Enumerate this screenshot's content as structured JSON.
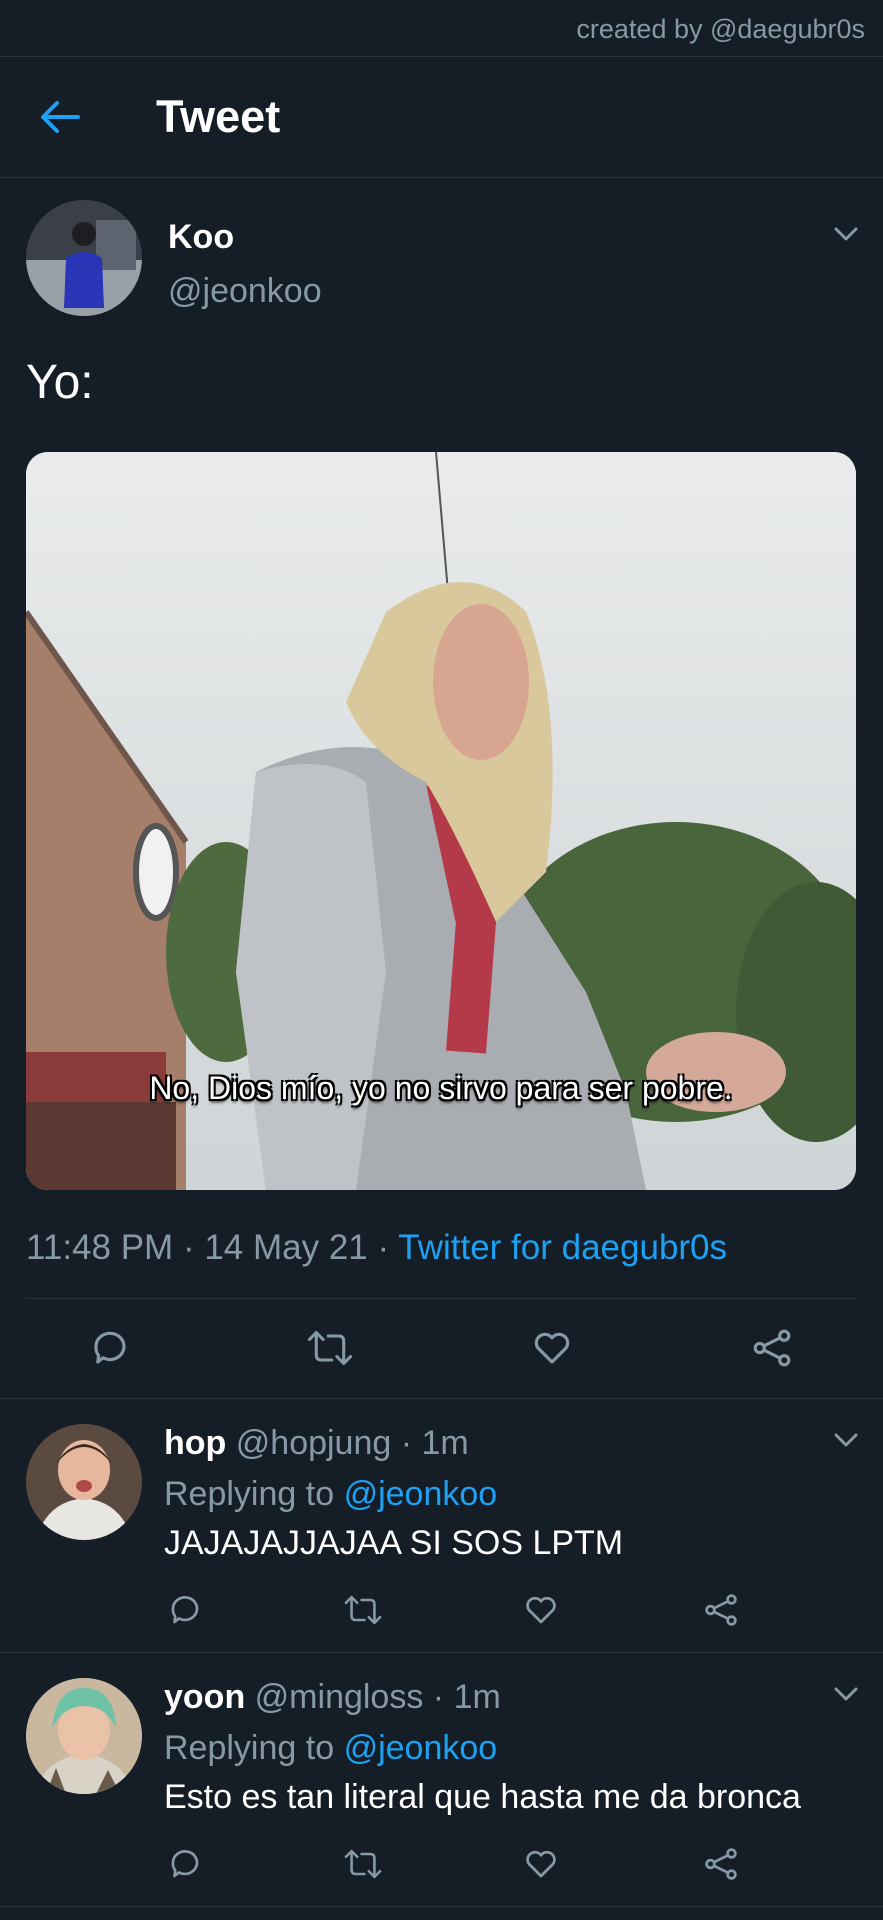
{
  "credit": "created by @daegubr0s",
  "header": {
    "title": "Tweet"
  },
  "tweet": {
    "author_name": "Koo",
    "author_handle": "@jeonkoo",
    "text": "Yo:",
    "media_subtitle": "No, Dios mío, yo no sirvo para ser pobre.",
    "time": "11:48 PM",
    "date": "14 May 21",
    "separator": " · ",
    "source": "Twitter for daegubr0s"
  },
  "replies": [
    {
      "name": "hop",
      "handle": "@hopjung",
      "time": "1m",
      "replying_label": "Replying to",
      "replying_to": "@jeonkoo",
      "text": "JAJAJAJJAJAA SI SOS LPTM"
    },
    {
      "name": "yoon",
      "handle": "@mingloss",
      "time": "1m",
      "replying_label": "Replying to",
      "replying_to": "@jeonkoo",
      "text": "Esto es tan literal que hasta me da bronca"
    }
  ],
  "icons": [
    "back-arrow-icon",
    "chevron-down-icon",
    "reply-icon",
    "retweet-icon",
    "like-icon",
    "share-icon"
  ],
  "colors": {
    "background": "#151d27",
    "accent": "#1da1f2",
    "muted": "#8899a6",
    "divider": "#2a3440"
  }
}
